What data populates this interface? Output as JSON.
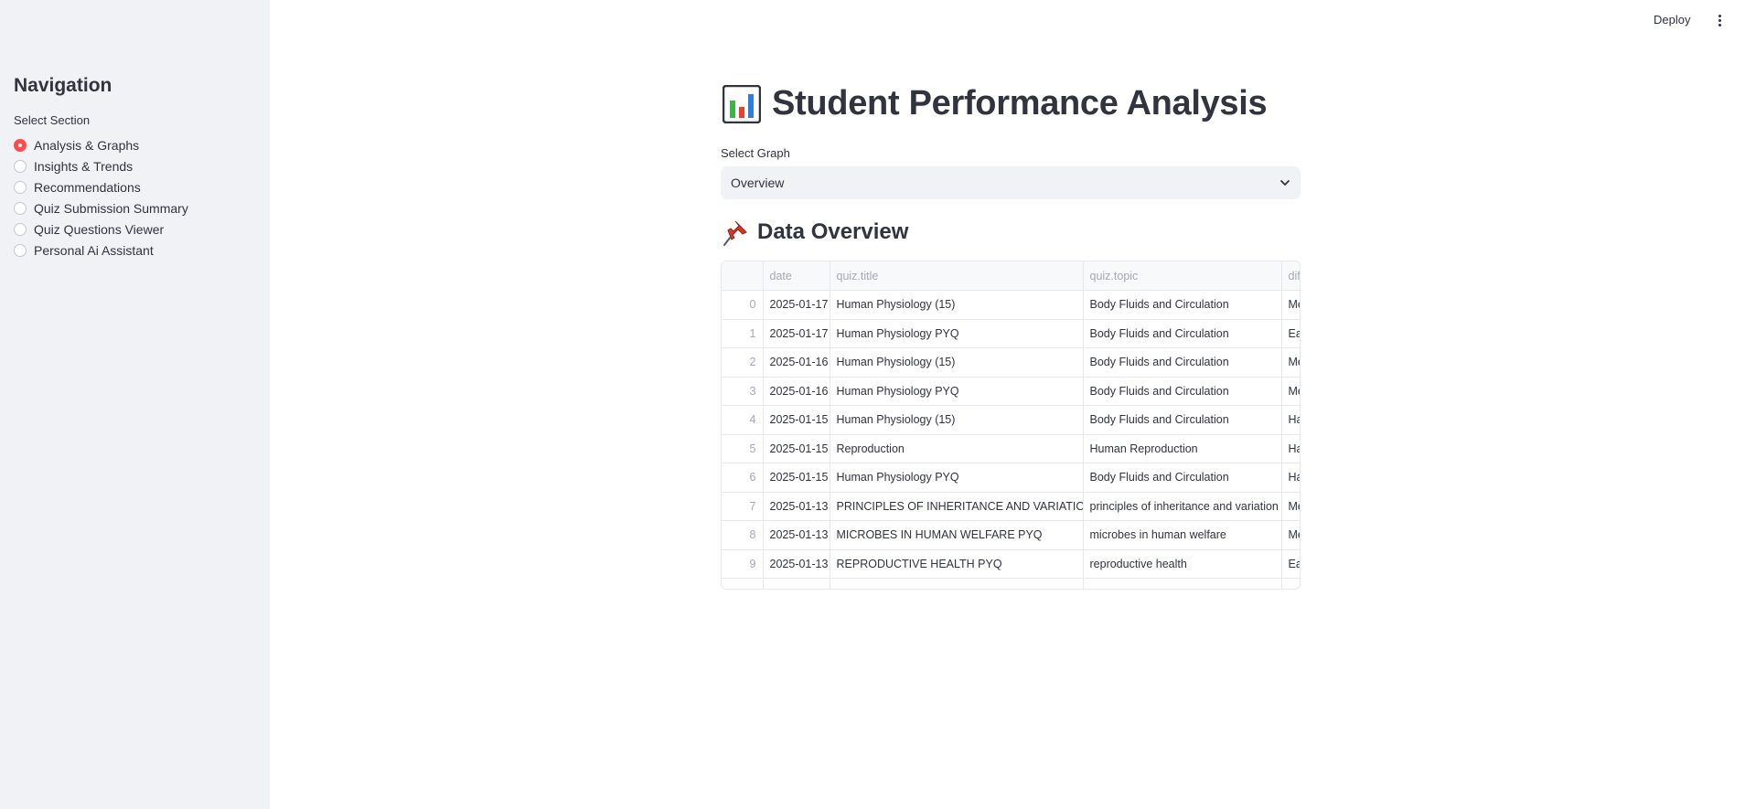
{
  "sidebar": {
    "title": "Navigation",
    "section_label": "Select Section",
    "items": [
      {
        "label": "Analysis & Graphs",
        "selected": true
      },
      {
        "label": "Insights & Trends",
        "selected": false
      },
      {
        "label": "Recommendations",
        "selected": false
      },
      {
        "label": "Quiz Submission Summary",
        "selected": false
      },
      {
        "label": "Quiz Questions Viewer",
        "selected": false
      },
      {
        "label": "Personal Ai Assistant",
        "selected": false
      }
    ]
  },
  "header": {
    "deploy_label": "Deploy",
    "menu_icon": "more-vertical-icon"
  },
  "main": {
    "title": "Student Performance Analysis",
    "title_icon": "bar-chart-icon",
    "select_label": "Select Graph",
    "select_value": "Overview",
    "section_title": "Data Overview",
    "section_icon": "pushpin-icon"
  },
  "table": {
    "columns": [
      "",
      "date",
      "quiz.title",
      "quiz.topic",
      "dif"
    ],
    "rows": [
      [
        "0",
        "2025-01-17",
        "Human Physiology (15)",
        "Body Fluids and Circulation",
        "Me"
      ],
      [
        "1",
        "2025-01-17",
        "Human Physiology PYQ",
        "Body Fluids and Circulation",
        "Ea"
      ],
      [
        "2",
        "2025-01-16",
        "Human Physiology (15)",
        "Body Fluids and Circulation",
        "Me"
      ],
      [
        "3",
        "2025-01-16",
        "Human Physiology PYQ",
        "Body Fluids and Circulation",
        "Me"
      ],
      [
        "4",
        "2025-01-15",
        "Human Physiology (15)",
        "Body Fluids and Circulation",
        "Ha"
      ],
      [
        "5",
        "2025-01-15",
        "Reproduction",
        "Human Reproduction",
        "Ha"
      ],
      [
        "6",
        "2025-01-15",
        "Human Physiology PYQ",
        "Body Fluids and Circulation",
        "Ha"
      ],
      [
        "7",
        "2025-01-13",
        "PRINCIPLES OF INHERITANCE AND VARIATION PYQ",
        "principles of inheritance and variation",
        "Me"
      ],
      [
        "8",
        "2025-01-13",
        "MICROBES IN HUMAN WELFARE  PYQ",
        "microbes in human welfare",
        "Me"
      ],
      [
        "9",
        "2025-01-13",
        "REPRODUCTIVE HEALTH PYQ",
        "reproductive health",
        "Ea"
      ],
      [
        "",
        "",
        "",
        "",
        ""
      ]
    ]
  },
  "colors": {
    "accent": "#ff4b4b",
    "sidebar_bg": "#f0f2f6",
    "text": "#31333f"
  }
}
